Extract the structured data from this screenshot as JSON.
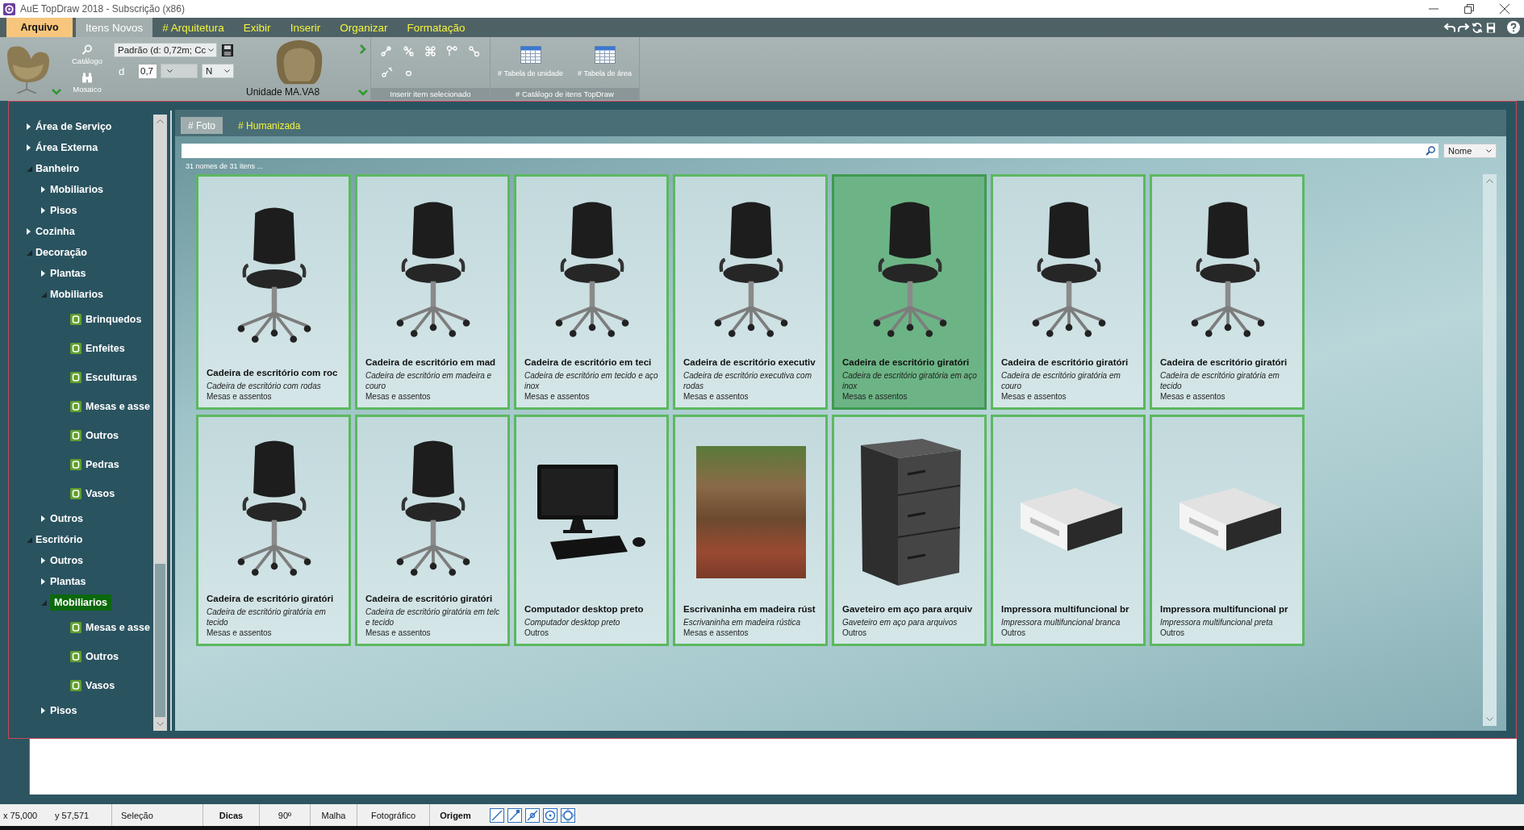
{
  "window": {
    "title": "AuE TopDraw 2018 - Subscrição (x86)"
  },
  "menu_tabs": [
    {
      "label": "Arquivo",
      "kind": "file",
      "selected": false
    },
    {
      "label": "Itens Novos",
      "kind": "tab",
      "selected": true
    },
    {
      "label": "# Arquitetura",
      "kind": "tab",
      "selected": false
    },
    {
      "label": "Exibir",
      "kind": "tab",
      "selected": false
    },
    {
      "label": "Inserir",
      "kind": "tab",
      "selected": false
    },
    {
      "label": "Organizar",
      "kind": "tab",
      "selected": false
    },
    {
      "label": "Formatação",
      "kind": "tab",
      "selected": false
    }
  ],
  "ribbon": {
    "catalog_button": {
      "label": "Catálogo"
    },
    "mosaic_button": {
      "label": "Mosaico"
    },
    "style_dropdown": {
      "value": "Padrão (d: 0,72m; Cc"
    },
    "size_label": "d",
    "size_input": {
      "value": "0,7"
    },
    "direction_dropdown": {
      "value": "N"
    },
    "unit_label": "Unidade MA.VA8",
    "insert_group": {
      "label": "Inserir item selecionado"
    },
    "catalog_group": {
      "label": "# Catálogo de itens TopDraw",
      "buttons": [
        {
          "label": "# Tabela de unidade"
        },
        {
          "label": "# Tabela de área"
        }
      ]
    }
  },
  "sidebar": {
    "tree": [
      {
        "label": "Área de Serviço",
        "expanded": false,
        "selected": false
      },
      {
        "label": "Área Externa",
        "expanded": false,
        "selected": false
      },
      {
        "label": "Banheiro",
        "expanded": true,
        "selected": false,
        "children": [
          {
            "label": "Mobiliarios",
            "expanded": false,
            "selected": false
          },
          {
            "label": "Pisos",
            "expanded": false,
            "selected": false
          }
        ]
      },
      {
        "label": "Cozinha",
        "expanded": false,
        "selected": false
      },
      {
        "label": "Decoração",
        "expanded": true,
        "selected": false,
        "children": [
          {
            "label": "Plantas",
            "expanded": false,
            "selected": false
          },
          {
            "label": "Mobiliarios",
            "expanded": true,
            "selected": false,
            "children": [
              {
                "label": "Brinquedos",
                "selected": false
              },
              {
                "label": "Enfeites",
                "selected": false
              },
              {
                "label": "Esculturas",
                "selected": false
              },
              {
                "label": "Mesas e asse",
                "selected": false
              },
              {
                "label": "Outros",
                "selected": false
              },
              {
                "label": "Pedras",
                "selected": false
              },
              {
                "label": "Vasos",
                "selected": false
              }
            ]
          },
          {
            "label": "Outros",
            "expanded": false,
            "selected": false
          }
        ]
      },
      {
        "label": "Escritório",
        "expanded": true,
        "selected": false,
        "children": [
          {
            "label": "Outros",
            "expanded": false,
            "selected": false
          },
          {
            "label": "Plantas",
            "expanded": false,
            "selected": false
          },
          {
            "label": "Mobiliarios",
            "expanded": true,
            "selected": true,
            "children": [
              {
                "label": "Mesas e asse",
                "selected": false
              },
              {
                "label": "Outros",
                "selected": false
              },
              {
                "label": "Vasos",
                "selected": false
              }
            ]
          },
          {
            "label": "Pisos",
            "expanded": false,
            "selected": false
          }
        ]
      }
    ]
  },
  "content": {
    "tabs": [
      {
        "label": "# Foto",
        "selected": true
      },
      {
        "label": "# Humanizada",
        "selected": false
      }
    ],
    "sort_dropdown": {
      "value": "Nome"
    },
    "result_count": "31 nomes de 31 itens ...",
    "items": [
      {
        "title": "Cadeira de escritório com roc",
        "description": "Cadeira de escritório com rodas",
        "category": "Mesas e assentos",
        "kind": "chair",
        "selected": false
      },
      {
        "title": "Cadeira de escritório em mad",
        "description": "Cadeira de escritório em madeira e couro",
        "category": "Mesas e assentos",
        "kind": "chair",
        "selected": false
      },
      {
        "title": "Cadeira de escritório em teci",
        "description": "Cadeira de escritório em tecido e aço inox",
        "category": "Mesas e assentos",
        "kind": "chair",
        "selected": false
      },
      {
        "title": "Cadeira de escritório executiv",
        "description": "Cadeira de escritório executiva com rodas",
        "category": "Mesas e assentos",
        "kind": "chair",
        "selected": false
      },
      {
        "title": "Cadeira de escritório giratóri",
        "description": "Cadeira de escritório giratória em aço inox",
        "category": "Mesas e assentos",
        "kind": "chair",
        "selected": true
      },
      {
        "title": "Cadeira de escritório giratóri",
        "description": "Cadeira de escritório giratória em couro",
        "category": "Mesas e assentos",
        "kind": "chair",
        "selected": false
      },
      {
        "title": "Cadeira de escritório giratóri",
        "description": "Cadeira de escritório giratória em tecido",
        "category": "Mesas e assentos",
        "kind": "chair",
        "selected": false
      },
      {
        "title": "Cadeira de escritório giratóri",
        "description": "Cadeira de escritório giratória em tecido",
        "category": "Mesas e assentos",
        "kind": "chair",
        "selected": false
      },
      {
        "title": "Cadeira de escritório giratóri",
        "description": "Cadeira de escritório giratória em telc e tecido",
        "category": "Mesas e assentos",
        "kind": "chair",
        "selected": false
      },
      {
        "title": "Computador desktop preto",
        "description": "Computador desktop preto",
        "category": "Outros",
        "kind": "computer",
        "selected": false
      },
      {
        "title": "Escrivaninha em madeira rúst",
        "description": "Escrivaninha em madeira rústica",
        "category": "Mesas e assentos",
        "kind": "photo",
        "selected": false
      },
      {
        "title": "Gaveteiro em aço para arquiv",
        "description": "Gaveteiro em aço para arquivos",
        "category": "Outros",
        "kind": "cabinet",
        "selected": false
      },
      {
        "title": "Impressora multifuncional br",
        "description": "Impressora multifuncional branca",
        "category": "Outros",
        "kind": "printer",
        "selected": false
      },
      {
        "title": "Impressora multifuncional pr",
        "description": "Impressora multifuncional preta",
        "category": "Outros",
        "kind": "printer",
        "selected": false
      }
    ]
  },
  "status_bar": {
    "x": "x 75,000",
    "y": "y 57,571",
    "mode": "Seleção",
    "toggles": [
      {
        "label": "Dicas",
        "on": true
      },
      {
        "label": "90º",
        "on": false
      },
      {
        "label": "Malha",
        "on": false
      },
      {
        "label": "Fotográfico",
        "on": false
      },
      {
        "label": "Origem",
        "on": true
      }
    ]
  }
}
